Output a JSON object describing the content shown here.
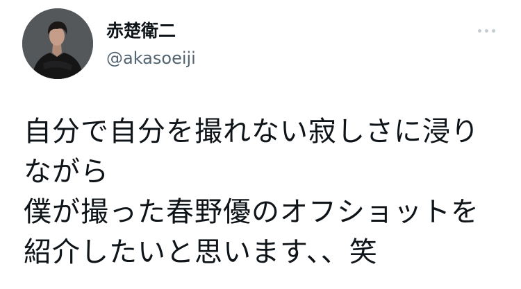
{
  "author": {
    "display_name": "赤楚衛二",
    "handle": "@akasoeiji"
  },
  "tweet": {
    "lines": [
      "自分で自分を撮れない寂しさに浸り",
      "ながら",
      "僕が撮った春野優のオフショットを",
      "紹介したいと思います、、笑"
    ]
  },
  "icons": {
    "more": "more-horizontal-icon"
  },
  "colors": {
    "text_primary": "#0f1419",
    "text_secondary": "#536471",
    "icon_muted": "#c4cbd1",
    "background": "#ffffff"
  }
}
